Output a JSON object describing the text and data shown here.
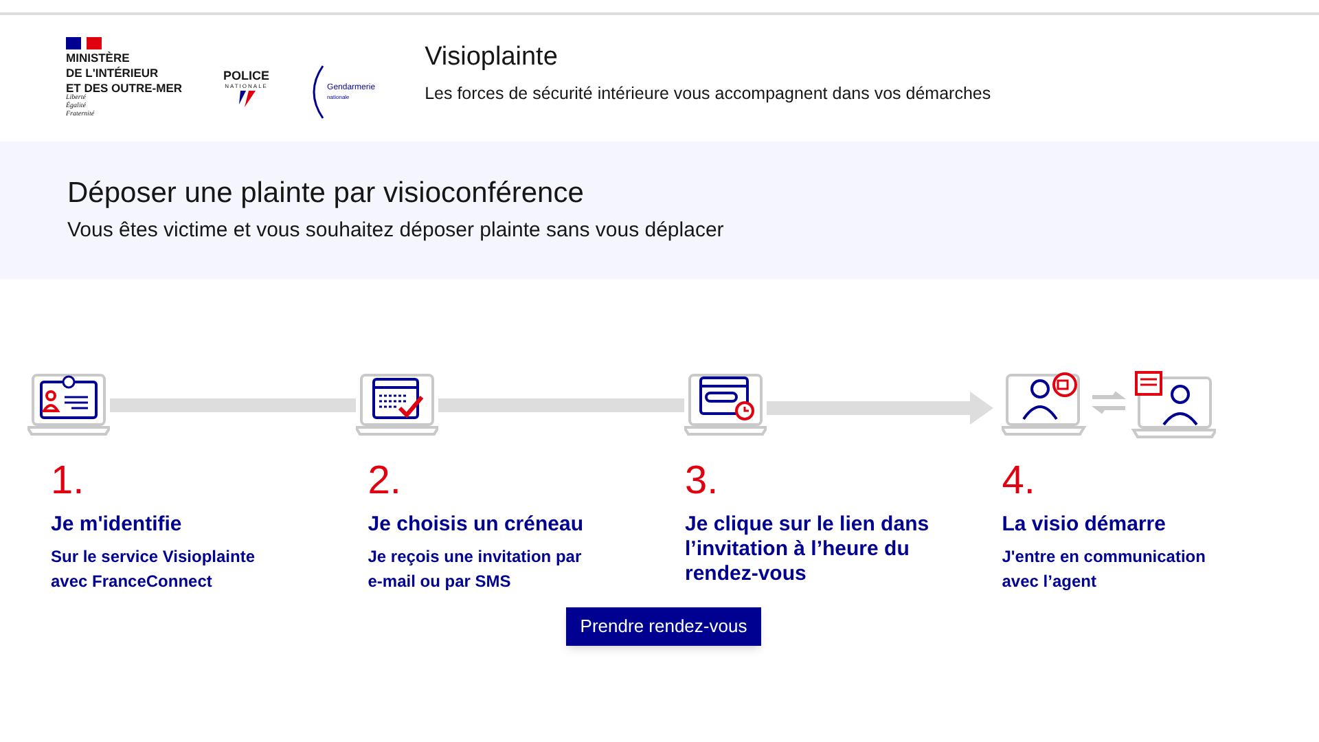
{
  "header": {
    "ministry": [
      "MINISTÈRE",
      "DE L'INTÉRIEUR",
      "ET DES OUTRE-MER"
    ],
    "motto": [
      "Liberté",
      "Égalité",
      "Fraternité"
    ],
    "police": {
      "name": "POLICE",
      "sub": "NATIONALE"
    },
    "gendarmerie": {
      "name": "Gendarmerie",
      "sub": "nationale"
    },
    "service_title": "Visioplainte",
    "service_tagline": "Les forces de sécurité intérieure vous accompagnent dans vos démarches"
  },
  "hero": {
    "title": "Déposer une plainte par visioconférence",
    "subtitle": "Vous êtes victime et vous souhaitez déposer plainte sans vous déplacer"
  },
  "steps": [
    {
      "kind": "identity",
      "number": "1.",
      "title": "Je m'identifie",
      "description": "Sur le service Visioplainte avec FranceConnect"
    },
    {
      "kind": "calendar",
      "number": "2.",
      "title": "Je choisis un créneau",
      "description": "Je reçois une invitation par e-mail ou par SMS"
    },
    {
      "kind": "link",
      "number": "3.",
      "title": "Je clique sur le lien dans l’invitation à l’heure du rendez-vous"
    },
    {
      "kind": "video",
      "number": "4.",
      "title": "La visio démarre",
      "description": "J'entre en communication avec l’agent"
    }
  ],
  "button": "Prendre rendez-vous"
}
